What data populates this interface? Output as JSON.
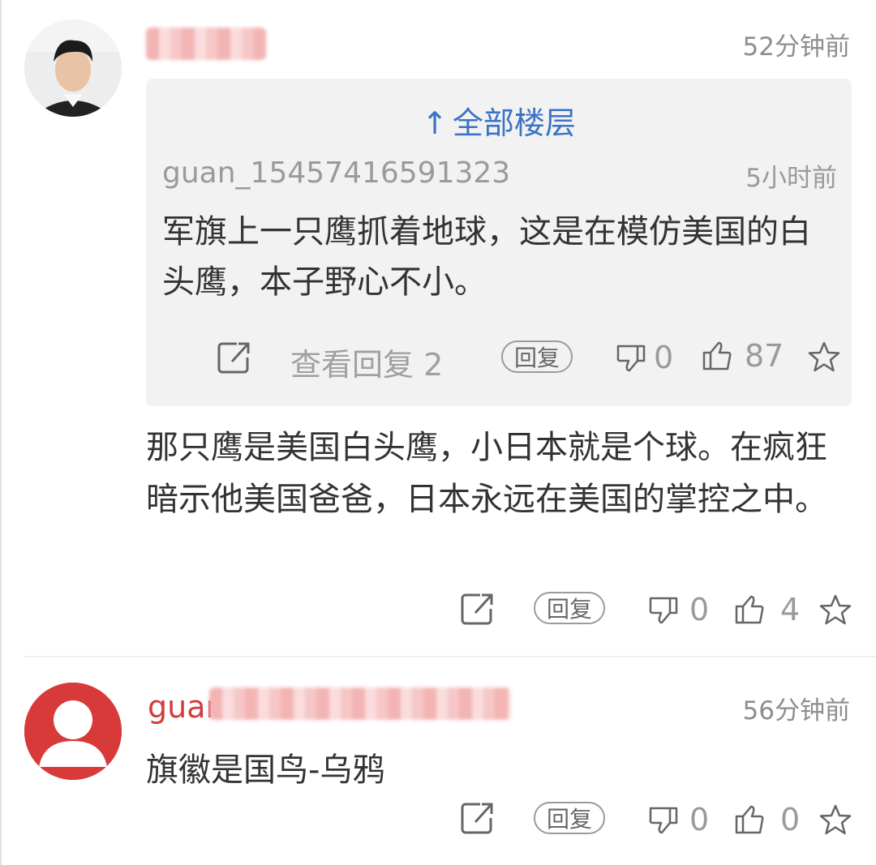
{
  "comments": [
    {
      "time": "52分钟前",
      "quoted": {
        "all_floors": "全部楼层",
        "arrow": "↑",
        "user": "guan_15457416591323",
        "time": "5小时前",
        "text": "军旗上一只鹰抓着地球，这是在模仿美国的白头鹰，本子野心不小。",
        "view_replies": "查看回复 2",
        "reply_label": "回复",
        "dislikes": "0",
        "likes": "87"
      },
      "text": "那只鹰是美国白头鹰，小日本就是个球。在疯狂暗示他美国爸爸，日本永远在美国的掌控之中。",
      "reply_label": "回复",
      "dislikes": "0",
      "likes": "4"
    },
    {
      "user_prefix": "guan",
      "time": "56分钟前",
      "text": "旗徽是国鸟-乌鸦",
      "reply_label": "回复",
      "dislikes": "0",
      "likes": "0"
    }
  ],
  "colors": {
    "username_red": "#d23c3c",
    "link_blue": "#3b73c6",
    "quote_bg": "#f2f2f2"
  },
  "icons": [
    "share-icon",
    "thumbs-down-icon",
    "thumbs-up-icon",
    "star-icon"
  ]
}
